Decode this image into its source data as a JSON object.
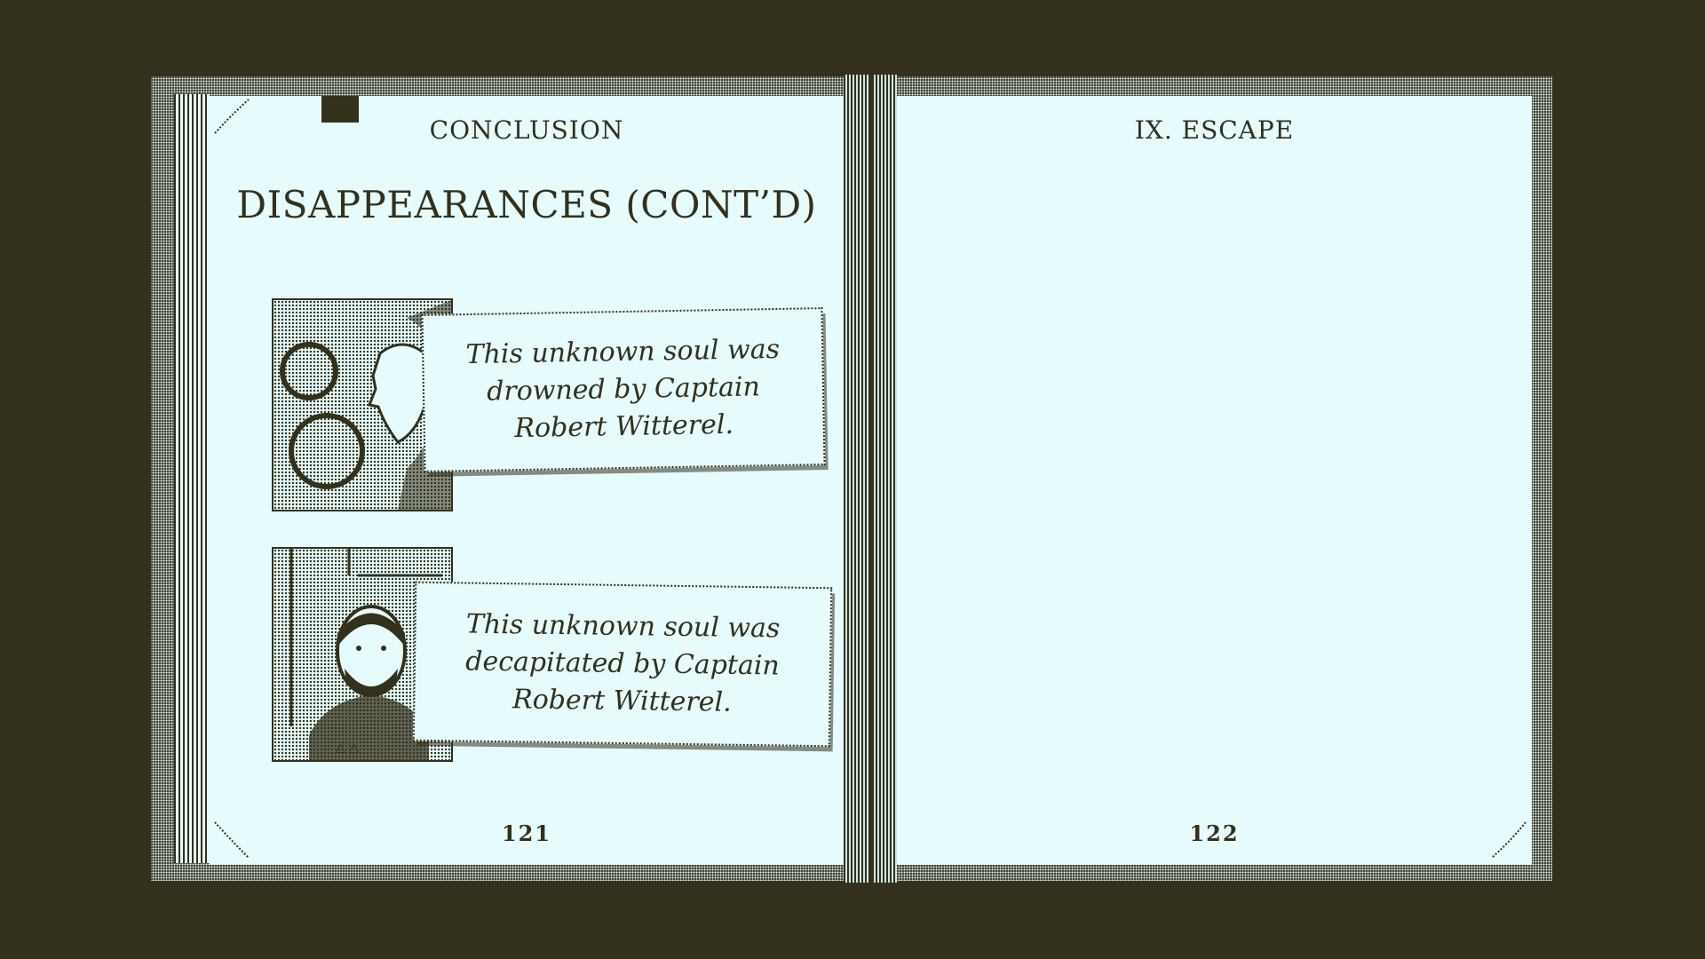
{
  "left_page": {
    "header": "CONCLUSION",
    "title": "DISAPPEARANCES (CONT’D)",
    "page_number": "121",
    "entries": [
      {
        "portrait_icon": "woman-profile-portrait",
        "note": "This unknown soul was drowned by Captain Robert Witterel."
      },
      {
        "portrait_icon": "bearded-man-portrait",
        "note": "This unknown soul was decapitated by Captain Robert Witterel."
      }
    ]
  },
  "right_page": {
    "header": "IX. ESCAPE",
    "page_number": "122"
  },
  "colors": {
    "ink": "#33301c",
    "paper": "#e6fbfb",
    "background": "#33301c"
  }
}
